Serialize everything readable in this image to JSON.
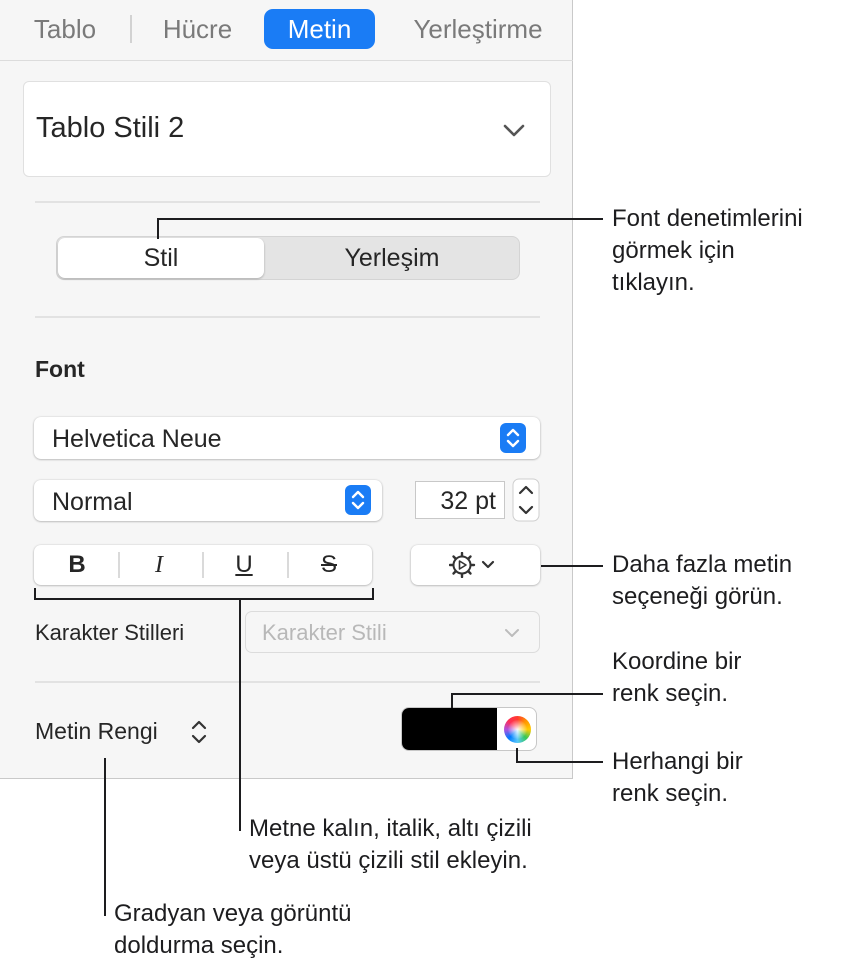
{
  "tabs": {
    "items": [
      {
        "label": "Tablo"
      },
      {
        "label": "Hücre"
      },
      {
        "label": "Metin"
      },
      {
        "label": "Yerleştirme"
      }
    ],
    "active": "Metin"
  },
  "table_style": {
    "value": "Tablo Stili 2"
  },
  "segment": {
    "style_label": "Stil",
    "layout_label": "Yerleşim",
    "selected": "Stil"
  },
  "font": {
    "section_label": "Font",
    "family": "Helvetica Neue",
    "typeface": "Normal",
    "size": "32 pt"
  },
  "format_buttons": {
    "bold": "B",
    "italic": "I",
    "underline": "U",
    "strikethrough": "S"
  },
  "character_styles": {
    "label": "Karakter Stilleri",
    "placeholder": "Karakter Stili"
  },
  "text_color": {
    "label": "Metin Rengi",
    "swatch_color": "#000000"
  },
  "callouts": {
    "font_controls": [
      "Font denetimlerini",
      "görmek için",
      "tıklayın."
    ],
    "more_options": [
      "Daha fazla metin",
      "seçeneği görün."
    ],
    "coordinated_color": [
      "Koordine bir",
      "renk seçin."
    ],
    "any_color": [
      "Herhangi bir",
      "renk seçin."
    ],
    "styles": [
      "Metne kalın, italik, altı çizili",
      "veya üstü çizili stil ekleyin."
    ],
    "fill": [
      "Gradyan veya görüntü",
      "doldurma seçin."
    ]
  },
  "colors": {
    "accent": "#1a7cf5",
    "panel_bg": "#f6f6f6"
  }
}
